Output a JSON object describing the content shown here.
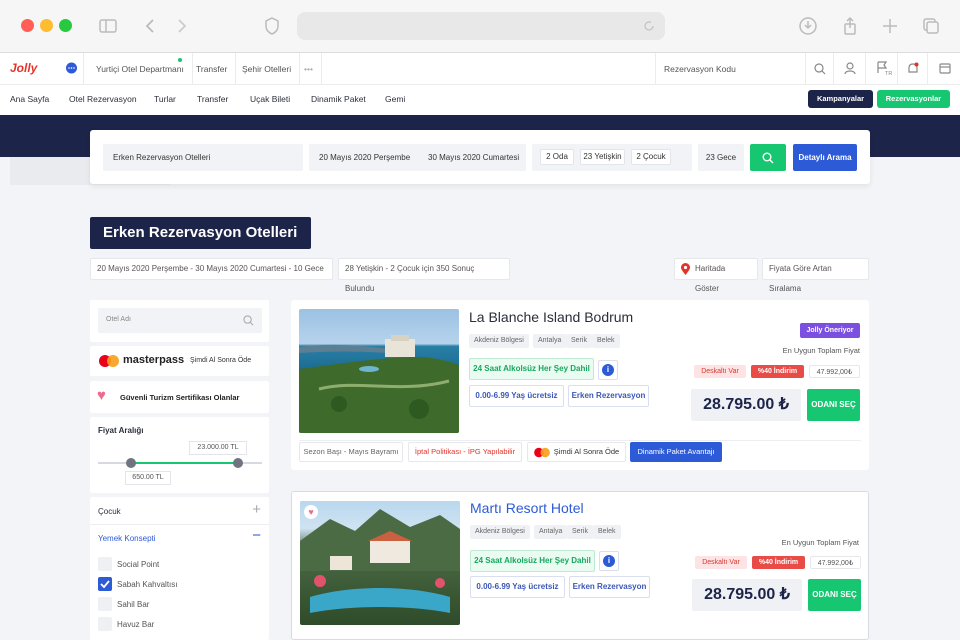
{
  "browser": {
    "mac_colors": [
      "#ff5f57",
      "#febc2e",
      "#28c840"
    ]
  },
  "topbar": {
    "logo": "Jolly",
    "items": [
      "Yurtiçi Otel Departmanı",
      "Transfer",
      "Şehir Otelleri",
      "•••"
    ],
    "reservation_code": "Rezervasyon Kodu",
    "lang": "TR"
  },
  "nav": {
    "items": [
      "Ana Sayfa",
      "Otel Rezervasyon",
      "Turlar",
      "Transfer",
      "Uçak Bileti",
      "Dinamik Paket",
      "Gemi"
    ],
    "campaigns": "Kampanyalar",
    "reservations": "Rezervasyonlar"
  },
  "search": {
    "query": "Erken Rezervasyon Otelleri",
    "date_from": "20 Mayıs 2020 Perşembe",
    "date_to": "30 Mayıs 2020 Cumartesi",
    "rooms": "2 Oda",
    "adults": "23 Yetişkin",
    "children": "2 Çocuk",
    "nights": "23 Gece",
    "detailed": "Detaylı Arama"
  },
  "page": {
    "title": "Erken Rezervasyon Otelleri",
    "date_info": "20 Mayıs 2020 Perşembe - 30 Mayıs 2020 Cumartesi - 10 Gece",
    "result_info": "28 Yetişkin - 2 Çocuk için 350 Sonuç Bulundu",
    "map": "Haritada Göster",
    "sort": "Fiyata Göre Artan Sıralama"
  },
  "filters": {
    "hotel_name_placeholder": "Otel Adı",
    "masterpass": "masterpass",
    "masterpass_note": "Şimdi Al Sonra Öde",
    "safe_tourism": "Güvenli Turizm Sertifikası Olanlar",
    "price_range": "Fiyat Aralığı",
    "price_max": "23.000.00 TL",
    "price_min": "650.00 TL",
    "price_min_fraction": 0.0,
    "price_max_fraction": 1.0,
    "child": "Çocuk",
    "meal_concept": "Yemek Konsepti",
    "meal_options": [
      {
        "label": "Social Point",
        "checked": false
      },
      {
        "label": "Sabah Kahvaltısı",
        "checked": true
      },
      {
        "label": "Sahil Bar",
        "checked": false
      },
      {
        "label": "Havuz Bar",
        "checked": false
      }
    ]
  },
  "hotels": [
    {
      "name": "La Blanche Island Bodrum",
      "tags": [
        "Akdeniz Bölgesi",
        "Antalya",
        "Serik",
        "Belek"
      ],
      "recommend": "Jolly Öneriyor",
      "best_price_label": "En Uygun Toplam Fiyat",
      "deposit": "Deskaltı Var",
      "discount": "%40 İndirim",
      "old_price": "47.992,00₺",
      "price": "28.795.00 ₺",
      "select": "ODANI SEÇ",
      "board": "24 Saat Alkolsüz Her Şey Dahil",
      "kids": "0.00-6.99 Yaş ücretsiz",
      "early": "Erken Rezervasyon",
      "chips": [
        "Sezon Başı - Mayıs Bayramı",
        "İptal Politikası - İPG Yapılabilir",
        "Şimdi Al Sonra Öde",
        "Dinamik Paket Avantajı"
      ]
    },
    {
      "name": "Martı Resort Hotel",
      "tags": [
        "Akdeniz Bölgesi",
        "Antalya",
        "Serik",
        "Belek"
      ],
      "best_price_label": "En Uygun Toplam Fiyat",
      "deposit": "Deskaltı Var",
      "discount": "%40 İndirim",
      "old_price": "47.992,00₺",
      "price": "28.795.00 ₺",
      "select": "ODANI SEÇ",
      "board": "24 Saat Alkolsüz Her Şey Dahil",
      "kids": "0.00-6.99 Yaş ücretsiz",
      "early": "Erken Rezervasyon"
    }
  ]
}
